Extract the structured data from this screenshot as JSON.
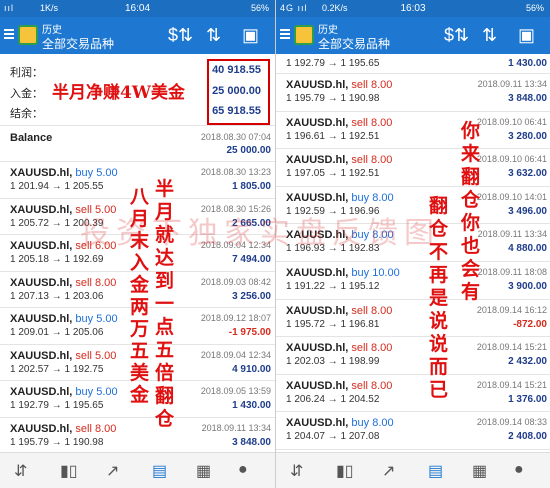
{
  "left": {
    "status": {
      "signal": "ııl",
      "net": "1K/s",
      "time": "16:04",
      "battery": "56%"
    },
    "appbar": {
      "title": "历史",
      "subtitle": "全部交易品种"
    },
    "summary": [
      {
        "label": "利润：",
        "value": "40 918.55"
      },
      {
        "label": "入金：",
        "value": "25 000.00"
      },
      {
        "label": "结余：",
        "value": "65 918.55"
      }
    ],
    "balance": {
      "label": "Balance",
      "date": "2018.08.30 07:04",
      "value": "25 000.00"
    },
    "trades": [
      {
        "sym": "XAUUSD.hl,",
        "side": "buy 5.00",
        "type": "buy",
        "prices": "1 201.94 → 1 205.55",
        "date": "2018.08.30 13:23",
        "pl": "1 805.00"
      },
      {
        "sym": "XAUUSD.hl,",
        "side": "sell 5.00",
        "type": "sell",
        "prices": "1 205.72 → 1 200.39",
        "date": "2018.08.30 15:26",
        "pl": "2 665.00"
      },
      {
        "sym": "XAUUSD.hl,",
        "side": "sell 6.00",
        "type": "sell",
        "prices": "1 205.18 → 1 192.69",
        "date": "2018.09.04 12:34",
        "pl": "7 494.00"
      },
      {
        "sym": "XAUUSD.hl,",
        "side": "sell 8.00",
        "type": "sell",
        "prices": "1 207.13 → 1 203.06",
        "date": "2018.09.03 08:42",
        "pl": "3 256.00"
      },
      {
        "sym": "XAUUSD.hl,",
        "side": "buy 5.00",
        "type": "buy",
        "prices": "1 209.01 → 1 205.06",
        "date": "2018.09.12 18:07",
        "pl": "-1 975.00"
      },
      {
        "sym": "XAUUSD.hl,",
        "side": "sell 5.00",
        "type": "sell",
        "prices": "1 202.57 → 1 192.75",
        "date": "2018.09.04 12:34",
        "pl": "4 910.00"
      },
      {
        "sym": "XAUUSD.hl,",
        "side": "buy 5.00",
        "type": "buy",
        "prices": "1 192.79 → 1 195.65",
        "date": "2018.09.05 13:59",
        "pl": "1 430.00"
      },
      {
        "sym": "XAUUSD.hl,",
        "side": "sell 8.00",
        "type": "sell",
        "prices": "1 195.79 → 1 190.98",
        "date": "2018.09.11 13:34",
        "pl": "3 848.00"
      }
    ],
    "annotations": {
      "headline": "半月净赚4W美金",
      "col1": "八月末入金两万五美金",
      "col2": "半月就达到一点五倍翻仓"
    }
  },
  "right": {
    "status": {
      "signal": "4G ııl",
      "net": "0.2K/s",
      "time": "16:03",
      "battery": "56%"
    },
    "appbar": {
      "title": "历史",
      "subtitle": "全部交易品种"
    },
    "top_partial": {
      "prices": "1 192.79 → 1 195.65",
      "pl": "1 430.00"
    },
    "trades": [
      {
        "sym": "XAUUSD.hl,",
        "side": "sell 8.00",
        "type": "sell",
        "prices": "1 195.79 → 1 190.98",
        "date": "2018.09.11 13:34",
        "pl": "3 848.00"
      },
      {
        "sym": "XAUUSD.hl,",
        "side": "sell 8.00",
        "type": "sell",
        "prices": "1 196.61 → 1 192.51",
        "date": "2018.09.10 06:41",
        "pl": "3 280.00"
      },
      {
        "sym": "XAUUSD.hl,",
        "side": "sell 8.00",
        "type": "sell",
        "prices": "1 197.05 → 1 192.51",
        "date": "2018.09.10 06:41",
        "pl": "3 632.00"
      },
      {
        "sym": "XAUUSD.hl,",
        "side": "buy 8.00",
        "type": "buy",
        "prices": "1 192.59 → 1 196.96",
        "date": "2018.09.10 14:01",
        "pl": "3 496.00"
      },
      {
        "sym": "XAUUSD.hl,",
        "side": "buy 8.00",
        "type": "buy",
        "prices": "1 196.93 → 1 192.83",
        "date": "2018.09.11 13:34",
        "pl": "4 880.00"
      },
      {
        "sym": "XAUUSD.hl,",
        "side": "buy 10.00",
        "type": "buy",
        "prices": "1 191.22 → 1 195.12",
        "date": "2018.09.11 18:08",
        "pl": "3 900.00"
      },
      {
        "sym": "XAUUSD.hl,",
        "side": "sell 8.00",
        "type": "sell",
        "prices": "1 195.72 → 1 196.81",
        "date": "2018.09.14 16:12",
        "pl": "-872.00"
      },
      {
        "sym": "XAUUSD.hl,",
        "side": "sell 8.00",
        "type": "sell",
        "prices": "1 202.03 → 1 198.99",
        "date": "2018.09.14 15:21",
        "pl": "2 432.00"
      },
      {
        "sym": "XAUUSD.hl,",
        "side": "sell 8.00",
        "type": "sell",
        "prices": "1 206.24 → 1 204.52",
        "date": "2018.09.14 15:21",
        "pl": "1 376.00"
      },
      {
        "sym": "XAUUSD.hl,",
        "side": "buy 8.00",
        "type": "buy",
        "prices": "1 204.07 → 1 207.08",
        "date": "2018.09.14 08:33",
        "pl": "2 408.00"
      }
    ],
    "annotations": {
      "col1": "你来翻仓你也会有",
      "col2": "翻仓不再是说说而已"
    }
  },
  "watermark": "投资下独家实盘反馈图",
  "icons": {
    "sort": "sort-arrows-icon",
    "currency": "currency-icon",
    "calendar": "calendar-icon",
    "bottom": [
      "quotes-icon",
      "chart-icon",
      "trade-icon",
      "history-icon",
      "news-icon",
      "chat-icon"
    ]
  }
}
